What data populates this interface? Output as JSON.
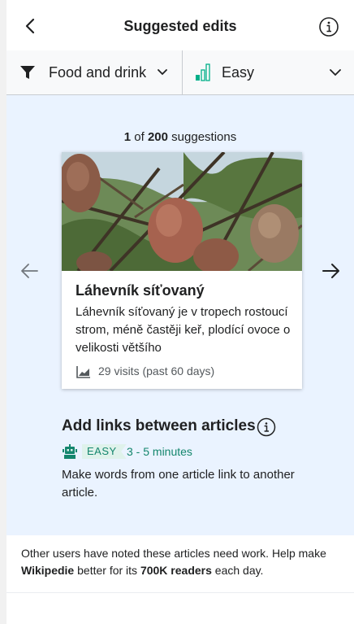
{
  "header": {
    "title": "Suggested edits"
  },
  "filters": {
    "topic": "Food and drink",
    "level": "Easy"
  },
  "counter": {
    "current": "1",
    "of": " of ",
    "total": "200",
    "suffix": " suggestions"
  },
  "card": {
    "title": "Láhevník síťovaný",
    "extract": "Láhevník síťovaný je v tropech rostoucí strom, méně častěji keř, plodící ovoce o velikosti většího",
    "visits": "29 visits (past 60 days)"
  },
  "task": {
    "title": "Add links between articles",
    "level_badge": "EASY",
    "time": "3 - 5 minutes",
    "description": "Make words from one article link to another article."
  },
  "footer": {
    "text_1": "Other users have noted these articles need work. Help make ",
    "site": "Wikipedie",
    "text_2": " better for its ",
    "readers": "700K readers",
    "text_3": " each day."
  },
  "colors": {
    "accent_green": "#14866d",
    "background_blue": "#eaf3ff",
    "level_green": "#00af89"
  },
  "icons": [
    "back-arrow-icon",
    "info-icon",
    "filter-funnel-icon",
    "chevron-down-icon",
    "difficulty-bars-icon",
    "arrow-left-icon",
    "arrow-right-icon",
    "visits-chart-icon",
    "robot-icon"
  ]
}
